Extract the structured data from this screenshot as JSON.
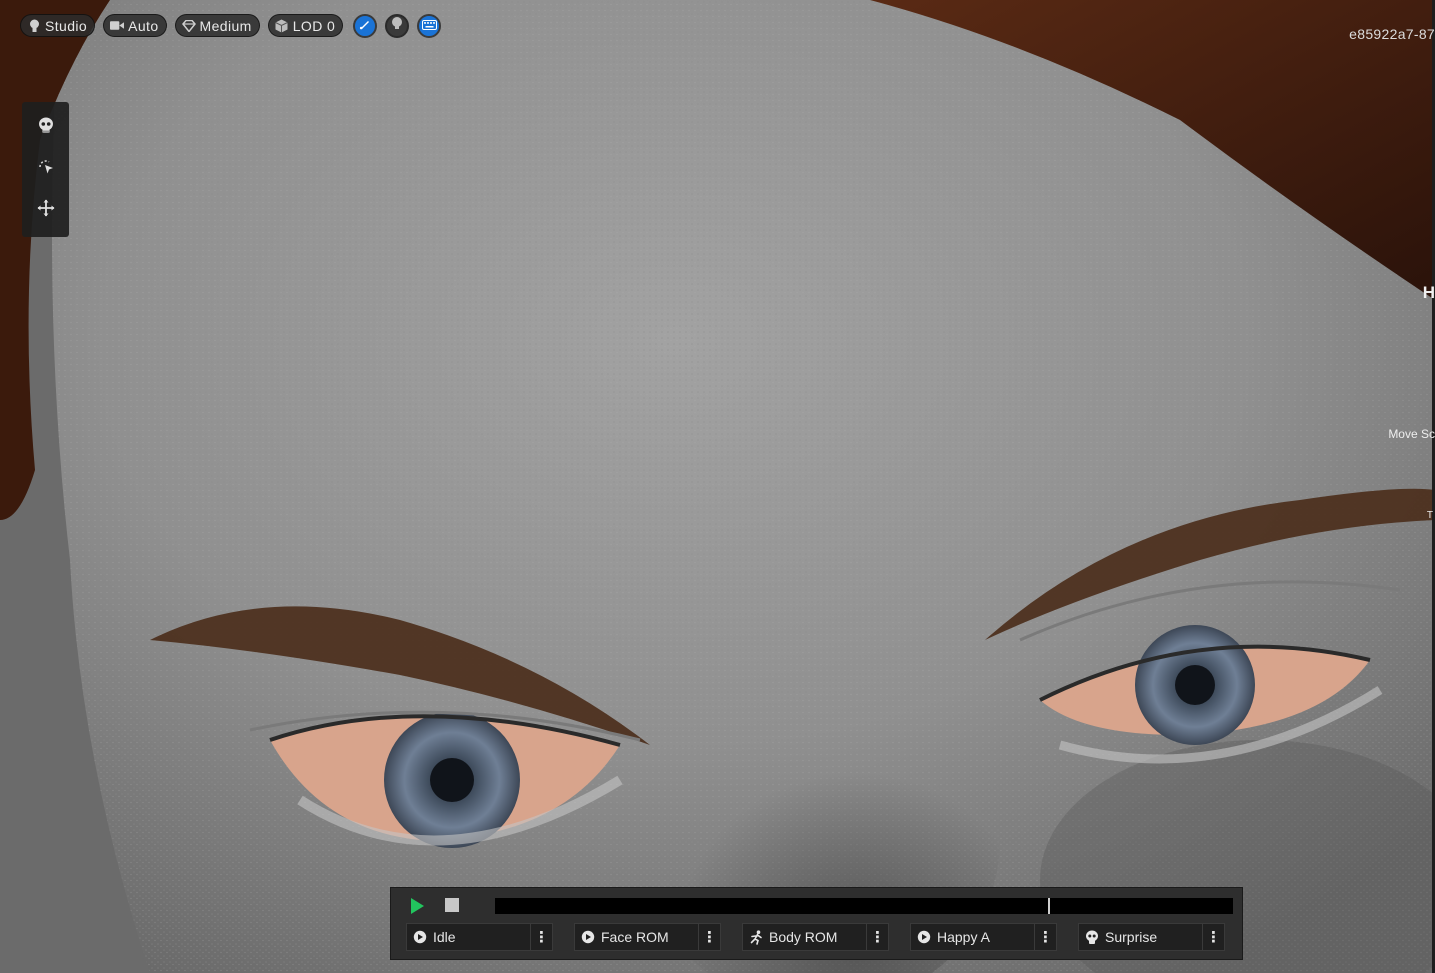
{
  "toolbar": {
    "lighting": {
      "label": "Studio",
      "icon": "lightbulb-icon"
    },
    "camera": {
      "label": "Auto",
      "icon": "video-camera-icon"
    },
    "quality": {
      "label": "Medium",
      "icon": "diamond-icon"
    },
    "lod": {
      "label": "LOD 0",
      "icon": "cube-icon"
    },
    "round_buttons": [
      {
        "icon": "pen-icon",
        "color": "#1a73d6"
      },
      {
        "icon": "head-icon",
        "color": "#3a3a3a"
      },
      {
        "icon": "keyboard-icon",
        "color": "#1a73d6"
      }
    ]
  },
  "viewport": {
    "session_id": "e85922a7-87",
    "edge_label": "H",
    "edge_hint": "Move Sc",
    "edge_mark": "T"
  },
  "side_tools": [
    {
      "icon": "skull-icon"
    },
    {
      "icon": "rotate-select-icon"
    },
    {
      "icon": "move-arrows-icon"
    }
  ],
  "animation": {
    "playing": false,
    "playhead_fraction": 0.751,
    "play_color": "#22c55e",
    "clips": [
      {
        "label": "Idle",
        "icon": "face-clip-icon"
      },
      {
        "label": "Face ROM",
        "icon": "face-clip-icon"
      },
      {
        "label": "Body ROM",
        "icon": "running-figure-icon"
      },
      {
        "label": "Happy A",
        "icon": "face-clip-icon"
      },
      {
        "label": "Surprise",
        "icon": "skull-clip-icon"
      }
    ],
    "menu_glyph": "⋮"
  }
}
